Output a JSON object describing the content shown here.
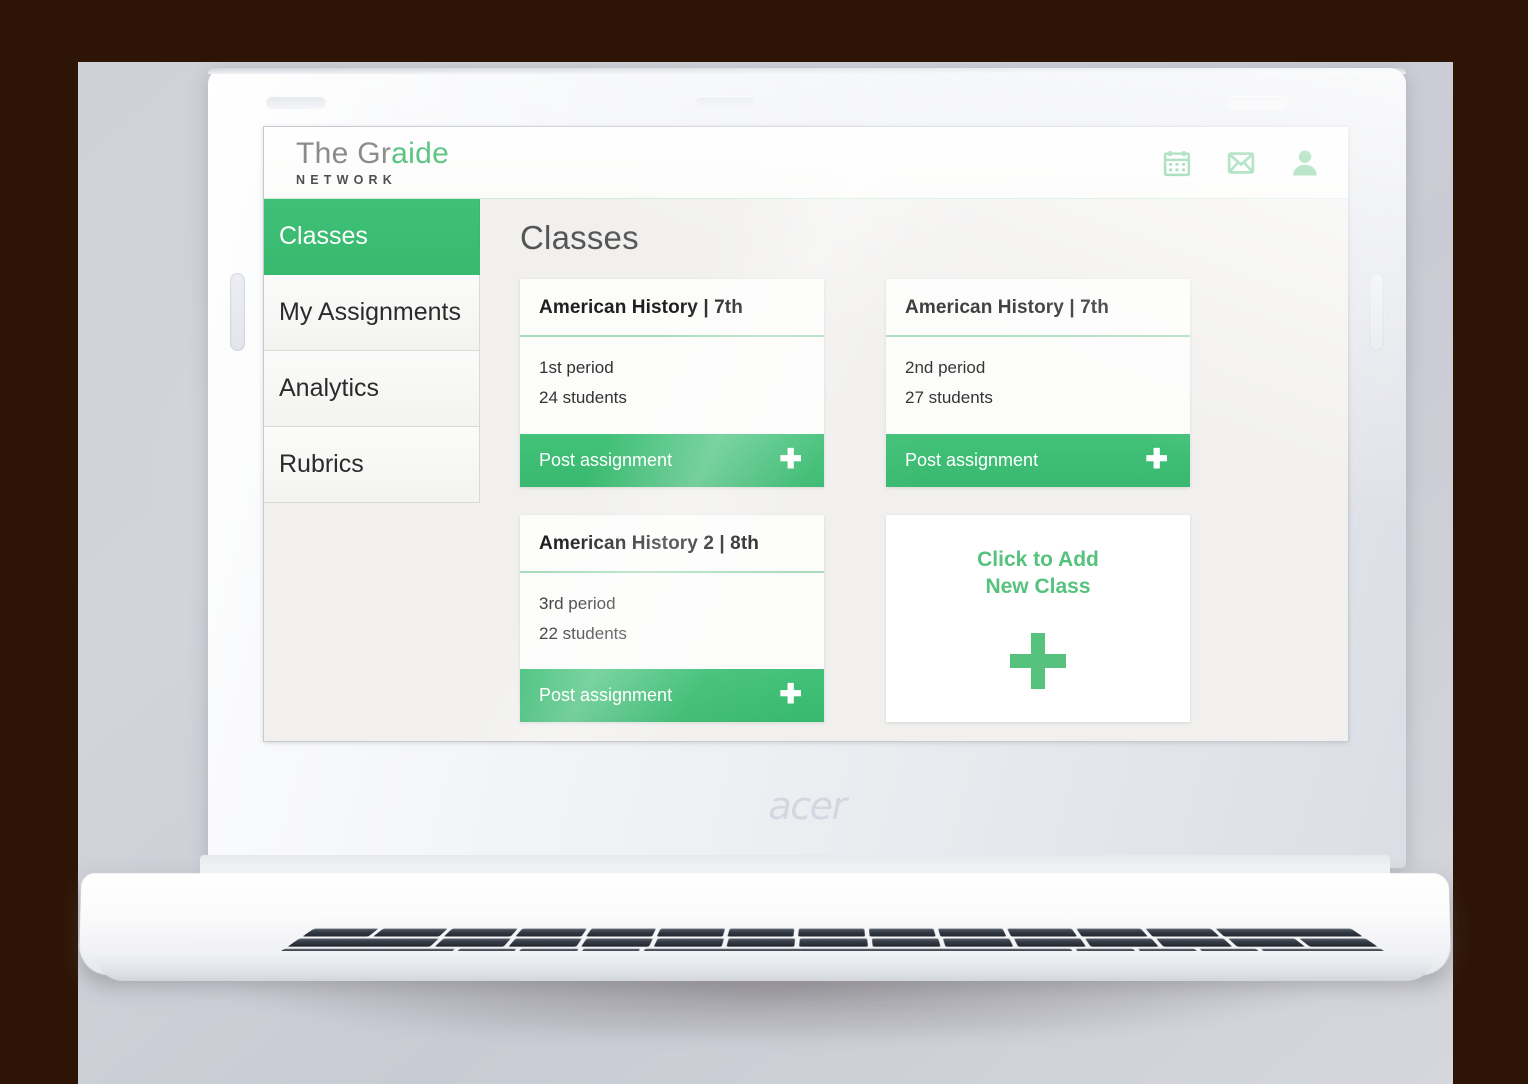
{
  "brand": {
    "logo_primary_gray": "The Gr",
    "logo_primary_accent": "aide",
    "logo_subtitle": "NETWORK",
    "accent_color": "#3fbf76",
    "logo_accent_color": "#56c27e",
    "laptop_brand": "acer"
  },
  "header": {
    "icons": [
      {
        "name": "calendar-icon",
        "label": "Calendar"
      },
      {
        "name": "mail-icon",
        "label": "Messages"
      },
      {
        "name": "user-icon",
        "label": "Account"
      }
    ]
  },
  "sidebar": {
    "items": [
      {
        "label": "Classes",
        "active": true
      },
      {
        "label": "My Assignments",
        "active": false
      },
      {
        "label": "Analytics",
        "active": false
      },
      {
        "label": "Rubrics",
        "active": false
      }
    ]
  },
  "main": {
    "page_title": "Classes",
    "cards": [
      {
        "title": "American History | 7th",
        "period": "1st period",
        "students": "24 students",
        "action_label": "Post assignment",
        "action_icon": "plus-icon"
      },
      {
        "title": "American History | 7th",
        "period": "2nd period",
        "students": "27 students",
        "action_label": "Post assignment",
        "action_icon": "plus-icon"
      },
      {
        "title": "American History 2 | 8th",
        "period": "3rd period",
        "students": "22 students",
        "action_label": "Post assignment",
        "action_icon": "plus-icon"
      }
    ],
    "add_card": {
      "line1": "Click to Add",
      "line2": "New Class",
      "icon": "plus-icon"
    }
  }
}
